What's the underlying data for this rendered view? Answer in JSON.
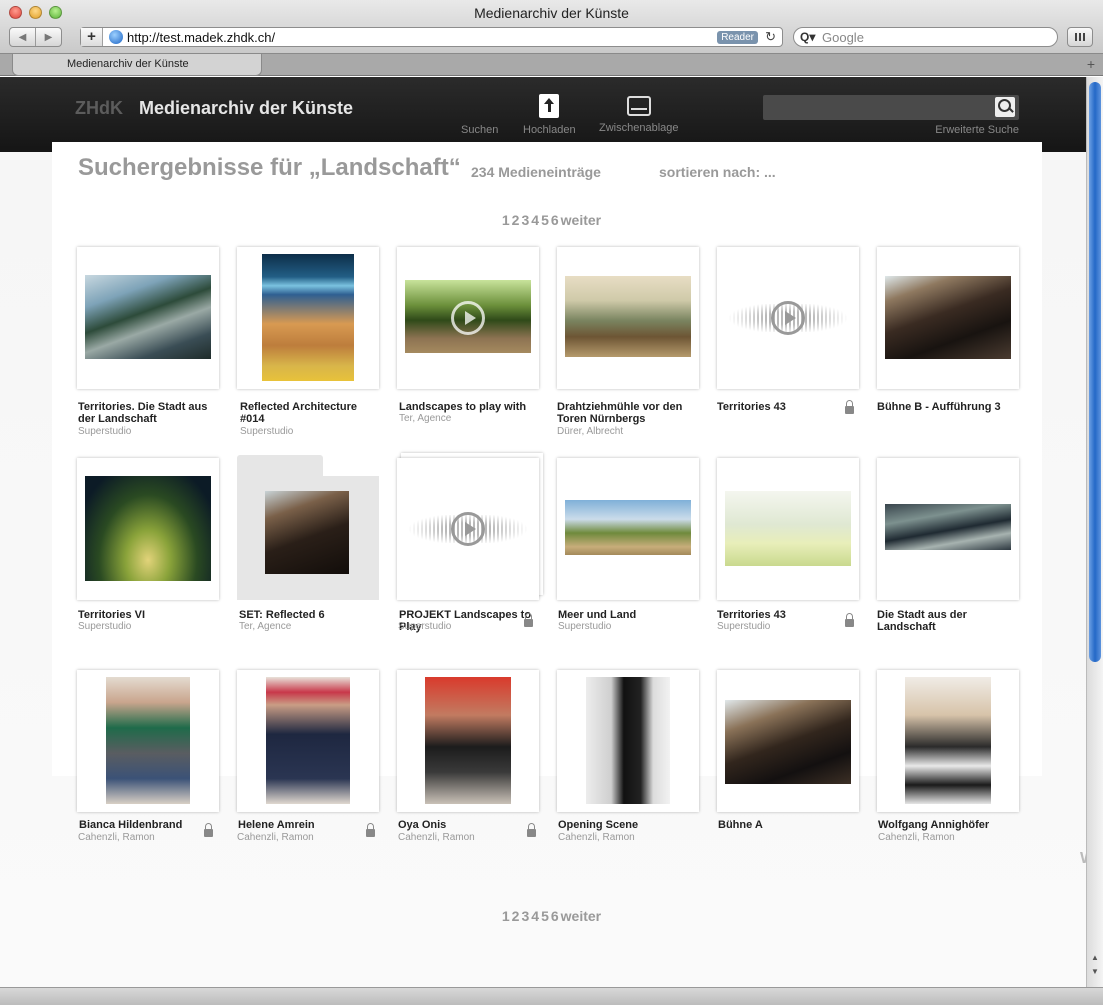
{
  "window": {
    "title": "Medienarchiv der Künste"
  },
  "toolbar": {
    "back": "◀",
    "forward": "▶",
    "add": "+",
    "url": "http://test.madek.zhdk.ch/",
    "reader": "Reader",
    "reload": "↻",
    "search_prefix": "Q▾",
    "search_placeholder": "Google"
  },
  "tab": {
    "label": "Medienarchiv der Künste",
    "new_tab": "+"
  },
  "header": {
    "logo": "ZHdK",
    "title": "Medienarchiv der Künste",
    "nav": [
      {
        "label": "Suchen",
        "icon": "search-nav"
      },
      {
        "label": "Hochladen",
        "icon": "upload-icon"
      },
      {
        "label": "Zwischenablage",
        "icon": "clipboard-tray-icon"
      }
    ],
    "search_placeholder": "",
    "advanced_search": "Erweiterte Suche"
  },
  "results": {
    "title": "Suchergebnisse für „Landschaft“",
    "count": "234 Medieneinträge",
    "sort": "sortieren nach: ..."
  },
  "pagination": {
    "pages": [
      "1",
      "2",
      "3",
      "4",
      "5",
      "6"
    ],
    "next": "weiter"
  },
  "items": [
    {
      "title": "Territories. Die Stadt aus der Landschaft",
      "author": "Superstudio",
      "kind": "image",
      "locked": false
    },
    {
      "title": "Reflected Architecture #014",
      "author": "Superstudio",
      "kind": "image",
      "locked": false
    },
    {
      "title": "Landscapes to play with",
      "author": "Ter, Agence",
      "kind": "video",
      "locked": false
    },
    {
      "title": "Drahtziehmühle vor den Toren Nürnbergs",
      "author": "Dürer, Albrecht",
      "kind": "image",
      "locked": false
    },
    {
      "title": "Territories 43",
      "author": "",
      "kind": "audio",
      "locked": true
    },
    {
      "title": "Bühne B - Aufführung 3",
      "author": "",
      "kind": "image",
      "locked": false
    },
    {
      "title": "Territories VI",
      "author": "Superstudio",
      "kind": "image",
      "locked": false
    },
    {
      "title": "SET: Reflected 6",
      "author": "Ter, Agence",
      "kind": "set",
      "locked": false
    },
    {
      "title": "PROJEKT Landscapes to Play",
      "author": "Superstudio",
      "kind": "project",
      "locked": true
    },
    {
      "title": "Meer und Land",
      "author": "Superstudio",
      "kind": "image",
      "locked": false
    },
    {
      "title": "Territories 43",
      "author": "Superstudio",
      "kind": "image",
      "locked": true
    },
    {
      "title": "Die Stadt aus der Landschaft",
      "author": "",
      "kind": "image",
      "locked": false
    },
    {
      "title": "Bianca Hildenbrand",
      "author": "Cahenzli, Ramon",
      "kind": "image",
      "locked": true
    },
    {
      "title": "Helene Amrein",
      "author": "Cahenzli, Ramon",
      "kind": "image",
      "locked": true
    },
    {
      "title": "Oya Onis",
      "author": "Cahenzli, Ramon",
      "kind": "image",
      "locked": true
    },
    {
      "title": "Opening Scene",
      "author": "Cahenzli, Ramon",
      "kind": "image",
      "locked": false
    },
    {
      "title": "Bühne A",
      "author": "",
      "kind": "image",
      "locked": false
    },
    {
      "title": "Wolfgang Annighöfer",
      "author": "Cahenzli, Ramon",
      "kind": "image",
      "locked": false
    }
  ],
  "edge_text": "We",
  "colors": {
    "header_bg": "#1e1e1e",
    "muted_text": "#999999",
    "scroll_accent": "#2468c7"
  }
}
